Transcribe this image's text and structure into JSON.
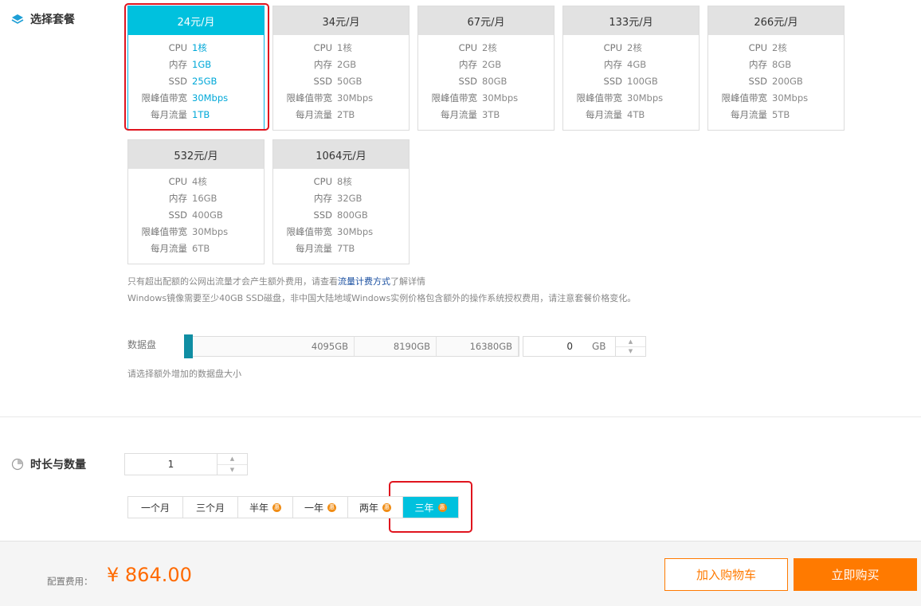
{
  "package_section": {
    "title": "选择套餐"
  },
  "plans": [
    {
      "price": "24元/月",
      "cpu": "1核",
      "memory": "1GB",
      "ssd": "25GB",
      "bandwidth": "30Mbps",
      "traffic": "1TB",
      "selected": true
    },
    {
      "price": "34元/月",
      "cpu": "1核",
      "memory": "2GB",
      "ssd": "50GB",
      "bandwidth": "30Mbps",
      "traffic": "2TB"
    },
    {
      "price": "67元/月",
      "cpu": "2核",
      "memory": "2GB",
      "ssd": "80GB",
      "bandwidth": "30Mbps",
      "traffic": "3TB"
    },
    {
      "price": "133元/月",
      "cpu": "2核",
      "memory": "4GB",
      "ssd": "100GB",
      "bandwidth": "30Mbps",
      "traffic": "4TB"
    },
    {
      "price": "266元/月",
      "cpu": "2核",
      "memory": "8GB",
      "ssd": "200GB",
      "bandwidth": "30Mbps",
      "traffic": "5TB"
    },
    {
      "price": "532元/月",
      "cpu": "4核",
      "memory": "16GB",
      "ssd": "400GB",
      "bandwidth": "30Mbps",
      "traffic": "6TB"
    },
    {
      "price": "1064元/月",
      "cpu": "8核",
      "memory": "32GB",
      "ssd": "800GB",
      "bandwidth": "30Mbps",
      "traffic": "7TB"
    }
  ],
  "spec_labels": {
    "cpu": "CPU",
    "memory": "内存",
    "ssd": "SSD",
    "bandwidth": "限峰值带宽",
    "traffic": "每月流量"
  },
  "notes": {
    "line1_pre": "只有超出配额的公网出流量才会产生额外费用，请查看",
    "line1_link": "流量计费方式",
    "line1_post": "了解详情",
    "line2": "Windows镜像需要至少40GB SSD磁盘，非中国大陆地域Windows实例价格包含额外的操作系统授权费用，请注意套餐价格变化。"
  },
  "data_disk": {
    "label": "数据盘",
    "ticks": [
      "4095GB",
      "8190GB",
      "16380GB"
    ],
    "value": "0",
    "unit": "GB",
    "hint": "请选择额外增加的数据盘大小"
  },
  "duration_section": {
    "title": "时长与数量",
    "quantity": "1",
    "options": [
      {
        "label": "一个月",
        "discount": false
      },
      {
        "label": "三个月",
        "discount": false
      },
      {
        "label": "半年",
        "discount": true
      },
      {
        "label": "一年",
        "discount": true
      },
      {
        "label": "两年",
        "discount": true
      },
      {
        "label": "三年",
        "discount": true,
        "active": true
      }
    ],
    "discount_glyph": "惠"
  },
  "footer": {
    "fee_label": "配置费用：",
    "fee": "¥ 864.00",
    "add_cart": "加入购物车",
    "buy_now": "立即购买"
  },
  "colors": {
    "accent": "#00c1de",
    "orange": "#ff7a00",
    "highlight": "#e0141e"
  }
}
